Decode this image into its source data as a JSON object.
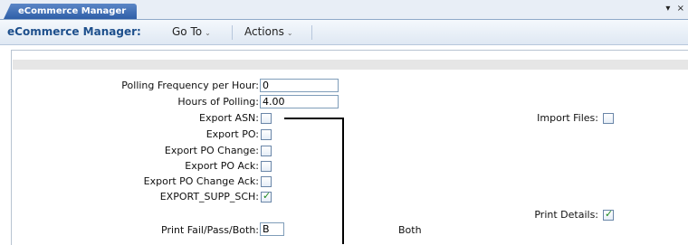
{
  "window": {
    "tab_label": "eCommerce Manager",
    "controls": "▾ ×"
  },
  "menubar": {
    "title": "eCommerce Manager:",
    "goto_label": "Go To",
    "actions_label": "Actions"
  },
  "form": {
    "polling_frequency": {
      "label": "Polling Frequency per Hour:",
      "value": "0"
    },
    "hours_of_polling": {
      "label": "Hours of Polling:",
      "value": "4.00"
    },
    "export_asn": {
      "label": "Export ASN:",
      "checked": false
    },
    "export_po": {
      "label": "Export PO:",
      "checked": false
    },
    "export_po_change": {
      "label": "Export PO Change:",
      "checked": false
    },
    "export_po_ack": {
      "label": "Export PO Ack:",
      "checked": false
    },
    "export_po_change_ack": {
      "label": "Export PO Change Ack:",
      "checked": false
    },
    "export_supp_sch": {
      "label": "EXPORT_SUPP_SCH:",
      "checked": true
    },
    "print_fail_pass_both": {
      "label": "Print Fail/Pass/Both:",
      "value": "B",
      "description": "Both"
    },
    "import_files": {
      "label": "Import Files:",
      "checked": false
    },
    "print_details": {
      "label": "Print Details:",
      "checked": true
    }
  }
}
